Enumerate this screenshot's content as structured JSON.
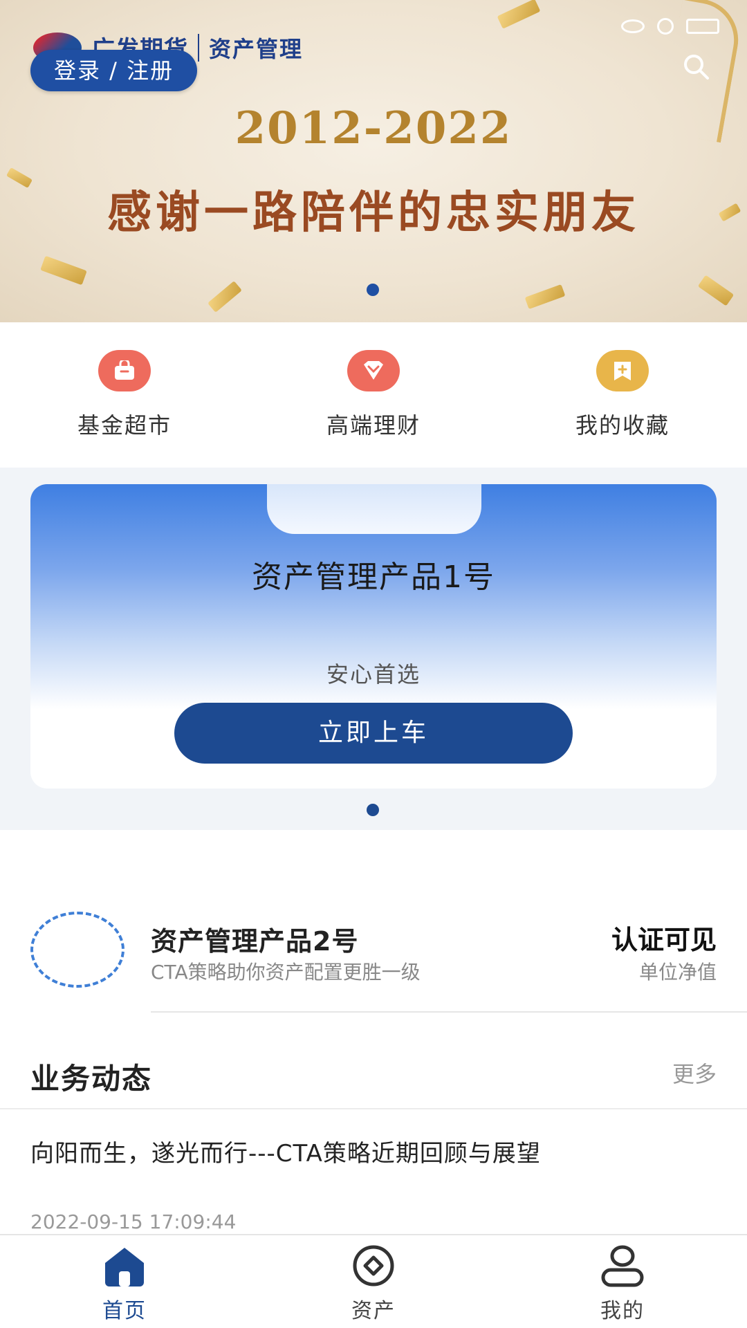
{
  "banner": {
    "logo_name": "广发期货",
    "logo_sub": "资产管理",
    "login_label": "登录 / 注册",
    "year_text": "2012-2022",
    "slogan": "感谢一路陪伴的忠实朋友"
  },
  "quick_entries": [
    {
      "label": "基金超市",
      "icon": "shopping-bag-icon",
      "color": "#ee6b5d"
    },
    {
      "label": "高端理财",
      "icon": "diamond-icon",
      "color": "#ee6b5d"
    },
    {
      "label": "我的收藏",
      "icon": "bookmark-icon",
      "color": "#e8b54a"
    }
  ],
  "product_card": {
    "title": "资产管理产品1号",
    "subtitle": "安心首选",
    "button_label": "立即上车"
  },
  "product_row": {
    "name": "资产管理产品2号",
    "description": "CTA策略助你资产配置更胜一级",
    "value": "认证可见",
    "value_label": "单位净值"
  },
  "news": {
    "section_title": "业务动态",
    "more_label": "更多",
    "item_title": "向阳而生，遂光而行---CTA策略近期回顾与展望",
    "item_time": "2022-09-15 17:09:44"
  },
  "tabbar": [
    {
      "label": "首页",
      "icon": "home-icon",
      "active": true
    },
    {
      "label": "资产",
      "icon": "asset-icon",
      "active": false
    },
    {
      "label": "我的",
      "icon": "user-icon",
      "active": false
    }
  ],
  "colors": {
    "primary": "#1d4a91",
    "accent_red": "#ee6b5d",
    "accent_gold": "#e8b54a"
  }
}
